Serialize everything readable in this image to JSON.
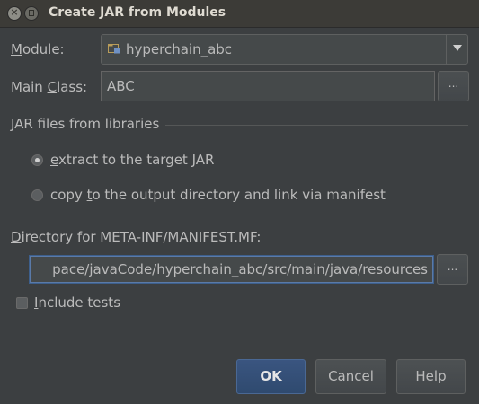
{
  "window": {
    "title": "Create JAR from Modules"
  },
  "module": {
    "label": "Module:",
    "value": "hyperchain_abc"
  },
  "main_class": {
    "label": "Main Class:",
    "value": "ABC"
  },
  "libraries": {
    "group_label": "JAR files from libraries",
    "options": [
      {
        "label": "extract to the target JAR",
        "selected": true
      },
      {
        "label": "copy to the output directory and link via manifest",
        "selected": false
      }
    ]
  },
  "manifest": {
    "label": "Directory for META-INF/MANIFEST.MF:",
    "value": "pace/javaCode/hyperchain_abc/src/main/java/resources"
  },
  "include_tests": {
    "label": "Include tests",
    "checked": false
  },
  "buttons": {
    "ok": "OK",
    "cancel": "Cancel",
    "help": "Help",
    "browse": "..."
  },
  "colors": {
    "background": "#3c3f41",
    "accent": "#2f4a6f",
    "focus_border": "#5a7aa8"
  }
}
